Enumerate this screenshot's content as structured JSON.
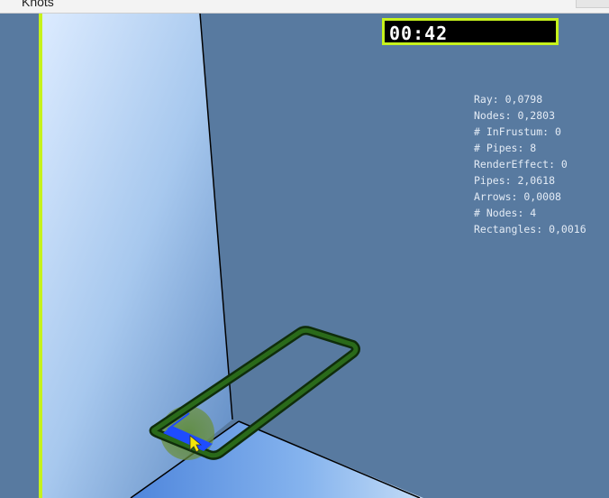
{
  "window": {
    "title": "Knots"
  },
  "hud": {
    "timer": "00:42"
  },
  "stats": [
    "Ray: 0,0798",
    "Nodes: 0,2803",
    "# InFrustum: 0",
    "# Pipes: 8",
    "RenderEffect: 0",
    "Pipes: 2,0618",
    "Arrows: 0,0008",
    "# Nodes: 4",
    "Rectangles: 0,0016"
  ],
  "colors": {
    "background": "#587aa0",
    "timer_border": "#c6f21c",
    "pipe": "#1a4d12",
    "highlight": "#1e4cff"
  }
}
